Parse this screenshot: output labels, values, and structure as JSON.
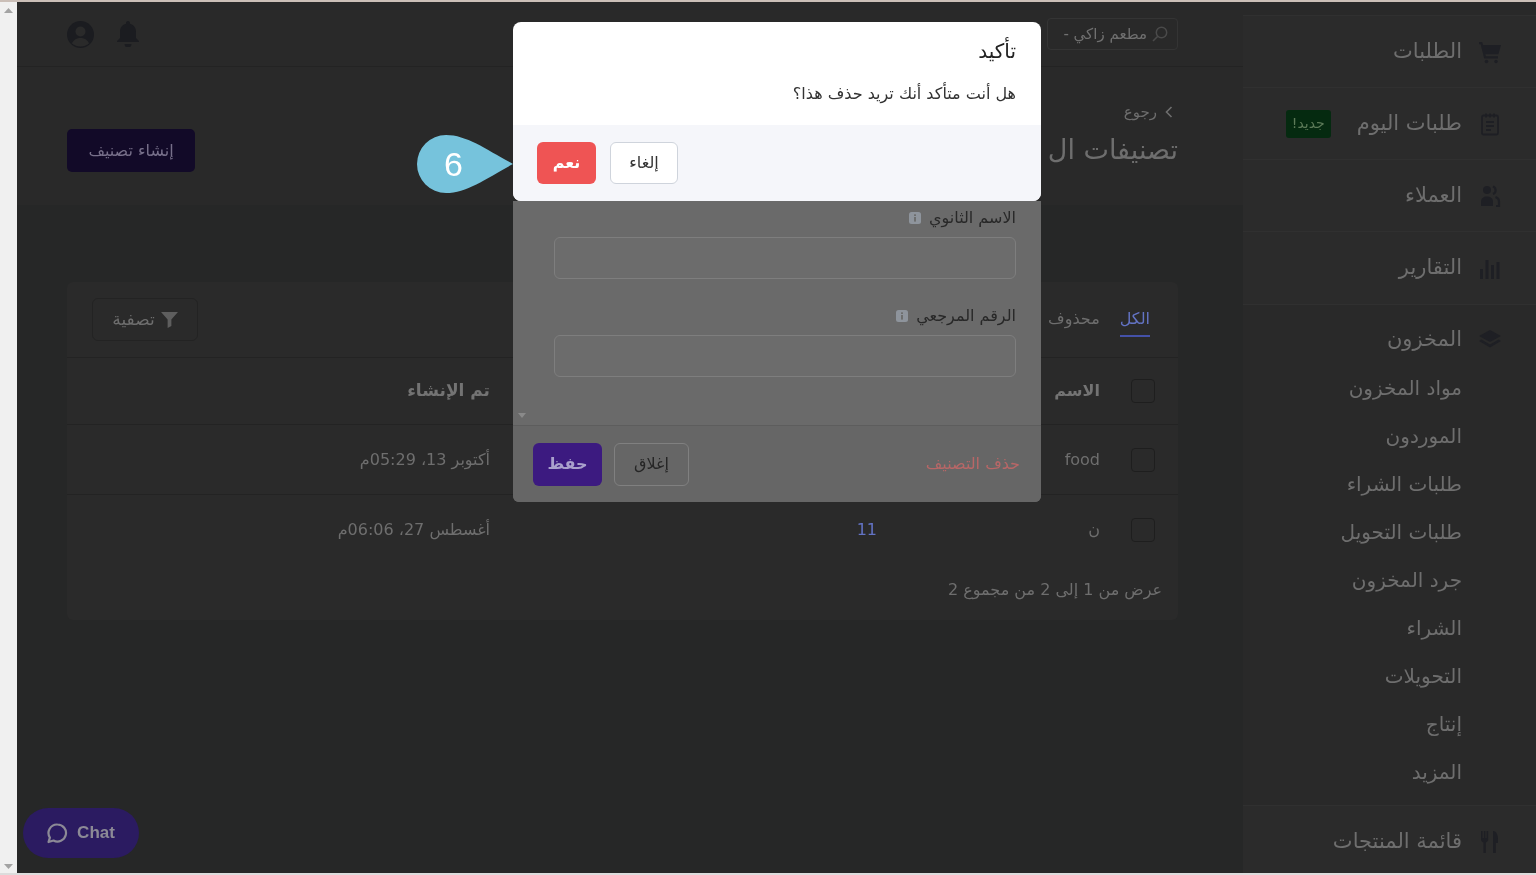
{
  "header": {
    "branch_field": {
      "value": "مطعم زاكي -"
    }
  },
  "sidebar": {
    "groups": [
      {
        "items": [
          {
            "label": "الطلبات"
          },
          {
            "label": "طلبات اليوم",
            "badge": "جديد!"
          },
          {
            "label": "العملاء"
          },
          {
            "label": "التقارير"
          }
        ]
      },
      {
        "items": [
          {
            "label": "المخزون",
            "children": [
              {
                "label": "مواد المخزون"
              },
              {
                "label": "الموردون"
              },
              {
                "label": "طلبات الشراء"
              },
              {
                "label": "طلبات التحويل"
              },
              {
                "label": "جرد المخزون"
              },
              {
                "label": "الشراء"
              },
              {
                "label": "التحويلات"
              },
              {
                "label": "إنتاج"
              },
              {
                "label": "المزيد"
              }
            ]
          }
        ]
      },
      {
        "items": [
          {
            "label": "قائمة المنتجات"
          }
        ]
      }
    ]
  },
  "page": {
    "back_link": "رجوع",
    "title": "تصنيفات ال",
    "create_button": "إنشاء تصنيف"
  },
  "categories_card": {
    "tabs": [
      {
        "label": "الكل",
        "selected": true
      },
      {
        "label": "محذوف",
        "selected": false
      }
    ],
    "filter_button": "تصفية",
    "table": {
      "select_all": {
        "checked": false
      },
      "columns": {
        "name": "الاسم",
        "created": "تم الإنشاء"
      },
      "rows": [
        {
          "checked": false,
          "name": "food",
          "created": "أكتوبر 13، 05:29م"
        },
        {
          "checked": false,
          "name": "ن",
          "column_2": "11",
          "created": "أغسطس 27، 06:06م"
        }
      ]
    },
    "footer": "عرض من 1 إلى 2 من مجموع 2"
  },
  "edit_dialog": {
    "fields": [
      {
        "label": "الاسم الثانوي"
      },
      {
        "label": "الرقم المرجعي"
      }
    ],
    "delete_link": "حذف التصنيف",
    "close_button": "إغلاق",
    "save_button": "حفظ"
  },
  "confirm_dialog": {
    "title": "تأكيد",
    "message": "هل أنت متأكد أنك تريد حذف هذا؟",
    "cancel_button": "إلغاء",
    "confirm_button": "نعم"
  },
  "callout": {
    "number": "6"
  },
  "chat_button": {
    "label": "Chat"
  }
}
